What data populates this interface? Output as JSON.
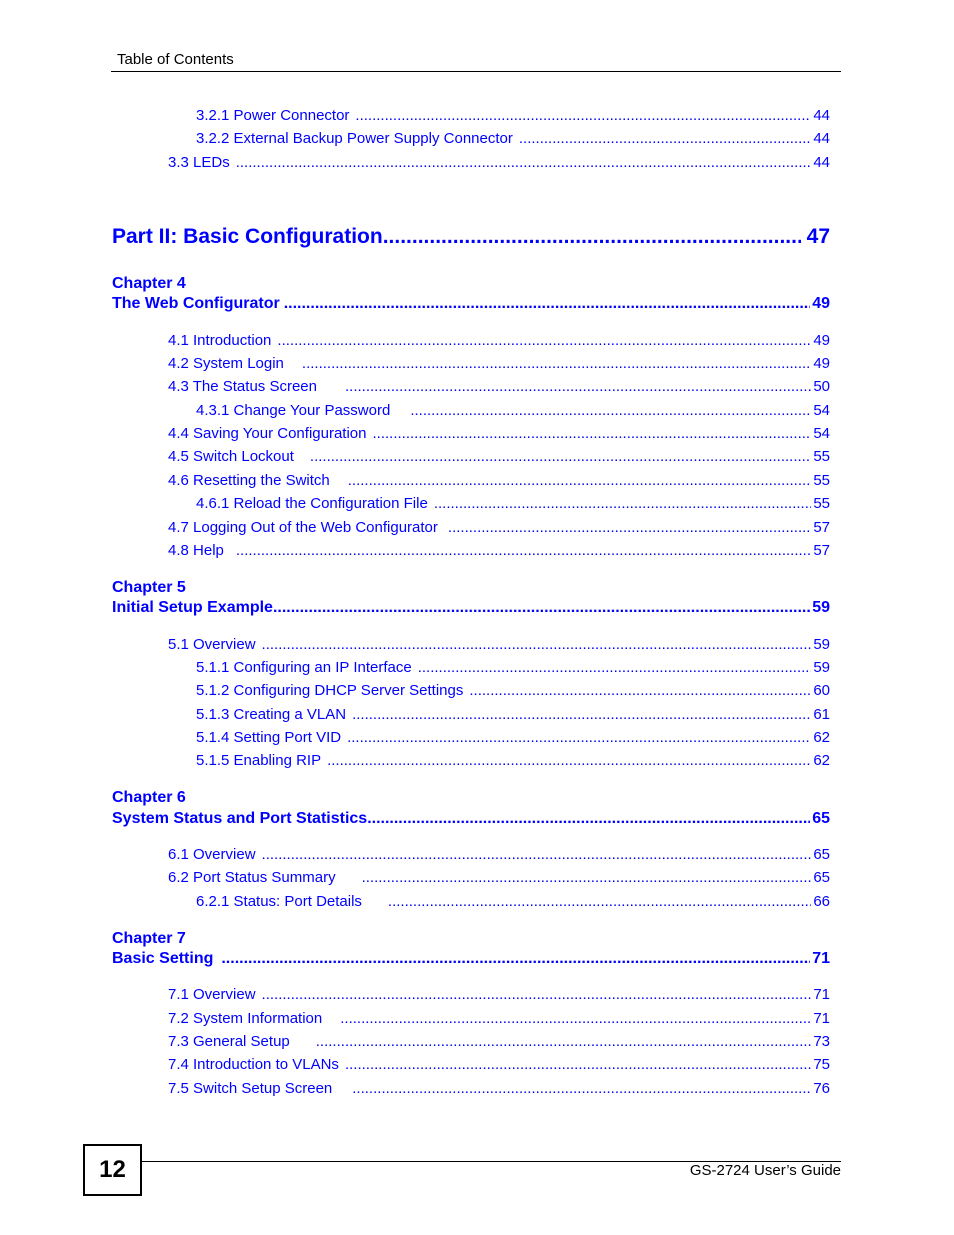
{
  "header": {
    "title": "Table of Contents"
  },
  "colors": {
    "link": "#0000ff"
  },
  "entries_top": [
    {
      "text": "3.2.1 Power Connector",
      "page": "44",
      "level": 2
    },
    {
      "text": "3.2.2 External Backup Power Supply Connector",
      "page": "44",
      "level": 2
    },
    {
      "text": "3.3 LEDs",
      "page": "44",
      "level": 1
    }
  ],
  "part": {
    "title": "Part II: Basic Configuration",
    "page": "47"
  },
  "chapters": [
    {
      "label": "Chapter  4",
      "title": "The Web Configurator",
      "page": "49",
      "sections": [
        {
          "text": "4.1 Introduction",
          "page": "49",
          "level": 1
        },
        {
          "text": "4.2 System Login",
          "page": "49",
          "level": 1
        },
        {
          "text": "4.3 The Status Screen",
          "page": "50",
          "level": 1
        },
        {
          "text": "4.3.1 Change Your Password",
          "page": "54",
          "level": 2
        },
        {
          "text": "4.4 Saving Your Configuration",
          "page": "54",
          "level": 1
        },
        {
          "text": "4.5 Switch Lockout",
          "page": "55",
          "level": 1
        },
        {
          "text": "4.6 Resetting the Switch",
          "page": "55",
          "level": 1
        },
        {
          "text": "4.6.1 Reload the Configuration File",
          "page": "55",
          "level": 2
        },
        {
          "text": "4.7 Logging Out of the Web Configurator",
          "page": "57",
          "level": 1
        },
        {
          "text": "4.8 Help",
          "page": "57",
          "level": 1
        }
      ]
    },
    {
      "label": "Chapter  5",
      "title": "Initial Setup Example",
      "page": "59",
      "sections": [
        {
          "text": "5.1 Overview",
          "page": "59",
          "level": 1
        },
        {
          "text": "5.1.1 Configuring an IP Interface",
          "page": "59",
          "level": 2
        },
        {
          "text": "5.1.2 Configuring DHCP Server Settings",
          "page": "60",
          "level": 2
        },
        {
          "text": "5.1.3 Creating a VLAN",
          "page": "61",
          "level": 2
        },
        {
          "text": "5.1.4 Setting Port VID",
          "page": "62",
          "level": 2
        },
        {
          "text": "5.1.5 Enabling RIP",
          "page": "62",
          "level": 2
        }
      ]
    },
    {
      "label": "Chapter  6",
      "title": "System Status and Port Statistics",
      "page": "65",
      "sections": [
        {
          "text": "6.1 Overview",
          "page": "65",
          "level": 1
        },
        {
          "text": "6.2 Port Status Summary",
          "page": "65",
          "level": 1
        },
        {
          "text": "6.2.1 Status: Port Details",
          "page": "66",
          "level": 2
        }
      ]
    },
    {
      "label": "Chapter  7",
      "title": "Basic Setting",
      "page": "71",
      "sections": [
        {
          "text": "7.1 Overview",
          "page": "71",
          "level": 1
        },
        {
          "text": "7.2 System Information",
          "page": "71",
          "level": 1
        },
        {
          "text": "7.3 General Setup",
          "page": "73",
          "level": 1
        },
        {
          "text": "7.4 Introduction to VLANs",
          "page": "75",
          "level": 1
        },
        {
          "text": "7.5 Switch Setup Screen",
          "page": "76",
          "level": 1
        }
      ]
    }
  ],
  "footer": {
    "page_number": "12",
    "guide_title": "GS-2724 User’s Guide"
  }
}
